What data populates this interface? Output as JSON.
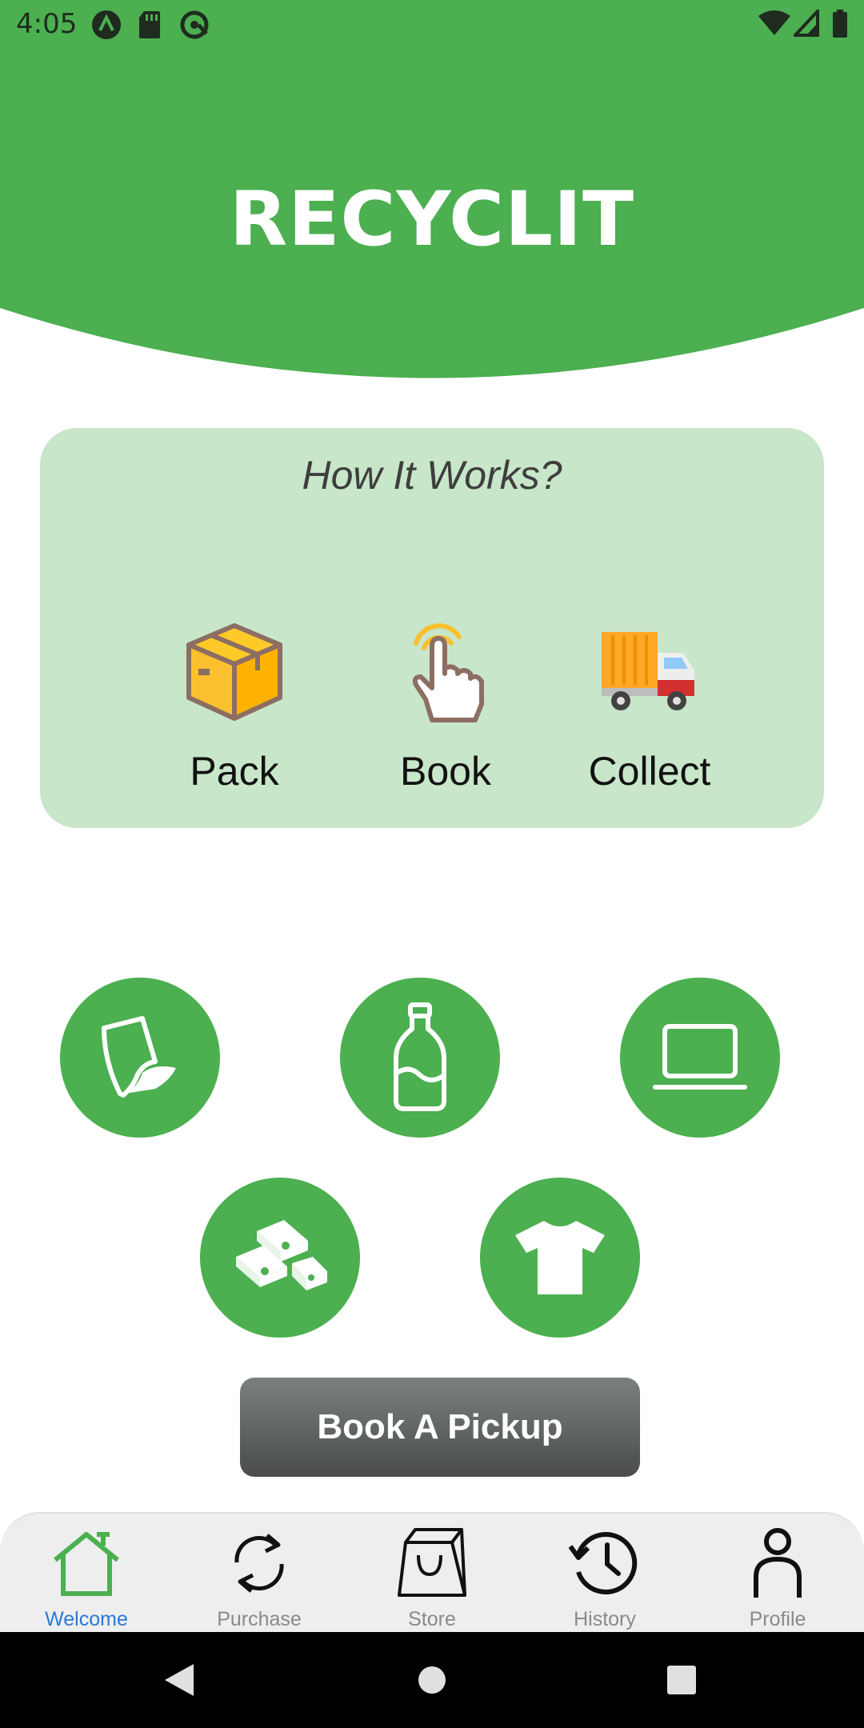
{
  "status_bar": {
    "time": "4:05"
  },
  "header": {
    "title": "RECYCLIT",
    "color": "#4caf50"
  },
  "how_it_works": {
    "title": "How It Works?",
    "steps": [
      {
        "label": "Pack",
        "icon": "box-icon"
      },
      {
        "label": "Book",
        "icon": "tap-hand-icon"
      },
      {
        "label": "Collect",
        "icon": "truck-icon"
      }
    ]
  },
  "categories": [
    {
      "icon": "paper-icon"
    },
    {
      "icon": "bottle-icon"
    },
    {
      "icon": "laptop-icon"
    },
    {
      "icon": "metal-bars-icon"
    },
    {
      "icon": "tshirt-icon"
    }
  ],
  "book_button": {
    "label": "Book A Pickup"
  },
  "bottom_nav": {
    "items": [
      {
        "label": "Welcome",
        "icon": "home-icon",
        "active": true
      },
      {
        "label": "Purchase",
        "icon": "refresh-icon",
        "active": false
      },
      {
        "label": "Store",
        "icon": "shopping-bag-icon",
        "active": false
      },
      {
        "label": "History",
        "icon": "history-clock-icon",
        "active": false
      },
      {
        "label": "Profile",
        "icon": "person-icon",
        "active": false
      }
    ],
    "active_color": "#2979d6"
  },
  "colors": {
    "primary_green": "#4caf50",
    "card_green": "#c8e6c9"
  }
}
